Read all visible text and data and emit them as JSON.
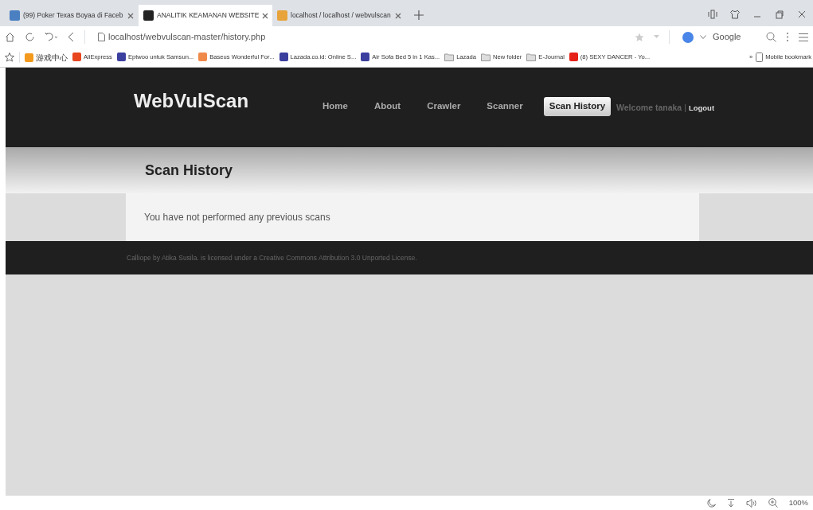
{
  "browser": {
    "tabs": [
      {
        "title": "(99) Poker Texas Boyaa di Faceb",
        "selected": false,
        "color": "#4a7fc1"
      },
      {
        "title": "ANALITIK KEAMANAN WEBSITE",
        "selected": true,
        "color": "#222222"
      },
      {
        "title": "localhost / localhost / webvulscan",
        "selected": false,
        "color": "#e8a33a"
      }
    ],
    "address": "localhost/webvulscan-master/history.php",
    "search_engine": "Google",
    "bookmarks": [
      {
        "label": "游戏中心",
        "kind": "site",
        "color": "#f39a1e"
      },
      {
        "label": "AliExpress",
        "kind": "site",
        "color": "#e8461f"
      },
      {
        "label": "Eptwoo untuk Samsun...",
        "kind": "site",
        "color": "#3b3f9e"
      },
      {
        "label": "Baseus Wonderful For...",
        "kind": "site",
        "color": "#f08a4b"
      },
      {
        "label": "Lazada.co.id: Online S...",
        "kind": "site",
        "color": "#3b3f9e"
      },
      {
        "label": "Air Sofa Bed 5 in 1 Kas...",
        "kind": "site",
        "color": "#3b3f9e"
      },
      {
        "label": "Lazada",
        "kind": "folder"
      },
      {
        "label": "New folder",
        "kind": "folder"
      },
      {
        "label": "E-Journal",
        "kind": "folder"
      },
      {
        "label": "(8) SEXY DANCER - Yo...",
        "kind": "site",
        "color": "#e62117"
      }
    ],
    "overflow": "»",
    "mobile_bookmarks": "Mobile bookmark",
    "zoom": "100%"
  },
  "site": {
    "brand": "WebVulScan",
    "nav": [
      {
        "label": "Home",
        "selected": false
      },
      {
        "label": "About",
        "selected": false
      },
      {
        "label": "Crawler",
        "selected": false
      },
      {
        "label": "Scanner",
        "selected": false
      },
      {
        "label": "Scan History",
        "selected": true
      }
    ],
    "welcome": "Welcome tanaka",
    "separator": "|",
    "logout": "Logout",
    "page_title": "Scan History",
    "message": "You have not performed any previous scans",
    "footer": {
      "prefix": "Calliope by ",
      "author": "Atika Susila",
      "middle": ". is licensed under a ",
      "license": "Creative Commons Attribution 3.0 Unported License",
      "suffix": "."
    }
  }
}
